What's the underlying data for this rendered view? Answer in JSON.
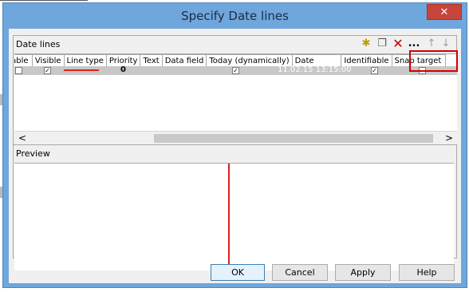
{
  "window": {
    "title": "Specify Date lines",
    "close_glyph": "✕"
  },
  "date_lines": {
    "group_title": "Date lines",
    "toolbar": [
      {
        "icon": "new-row-icon",
        "glyph": "✱"
      },
      {
        "icon": "copy-icon",
        "glyph": "❐"
      },
      {
        "icon": "delete-icon",
        "glyph": "✕"
      },
      {
        "icon": "more-icon",
        "glyph": "..."
      },
      {
        "icon": "move-up-icon",
        "glyph": "↑"
      },
      {
        "icon": "move-down-icon",
        "glyph": "↓"
      }
    ],
    "columns": [
      "eable",
      "Visible",
      "Line type",
      "Priority",
      "Text",
      "Data field",
      "Today (dynamically)",
      "Date",
      "Identifiable",
      "Snap target"
    ],
    "row": {
      "editable": false,
      "visible": true,
      "line_color": "#e02020",
      "priority": "0",
      "text": "",
      "data_field": "",
      "today_dynamically": true,
      "date": "11.02.15 13:15:00",
      "identifiable": true,
      "snap_target": false
    },
    "scroll_left": "<",
    "scroll_right": ">"
  },
  "preview": {
    "group_title": "Preview",
    "line_color": "#e02020"
  },
  "buttons": {
    "ok": "OK",
    "cancel": "Cancel",
    "apply": "Apply",
    "help": "Help"
  },
  "colors": {
    "titlebar": "#6fa6dc",
    "close": "#c7453a",
    "highlight": "#d00000"
  }
}
